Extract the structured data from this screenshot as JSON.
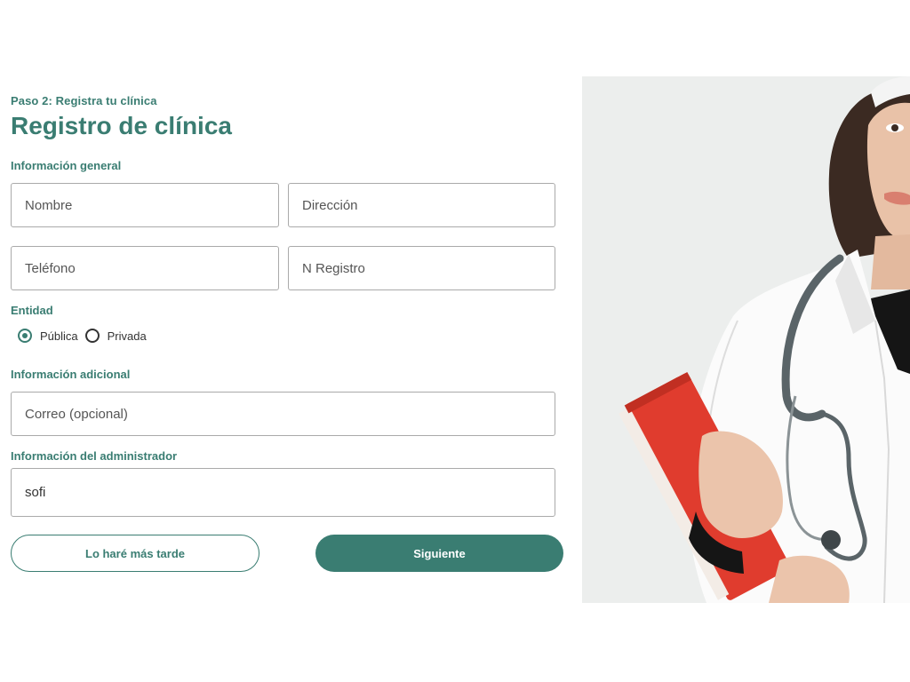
{
  "header": {
    "step": "Paso 2: Registra tu clínica",
    "title": "Registro de clínica"
  },
  "general": {
    "label": "Información general",
    "nombre_placeholder": "Nombre",
    "direccion_placeholder": "Dirección",
    "telefono_placeholder": "Teléfono",
    "registro_placeholder": "N Registro"
  },
  "entidad": {
    "label": "Entidad",
    "options": [
      {
        "label": "Pública",
        "selected": true
      },
      {
        "label": "Privada",
        "selected": false
      }
    ]
  },
  "adicional": {
    "label": "Información adicional",
    "correo_placeholder": "Correo (opcional)"
  },
  "admin": {
    "label": "Información del administrador",
    "value": "sofi"
  },
  "buttons": {
    "later": "Lo haré más tarde",
    "next": "Siguiente"
  },
  "colors": {
    "accent": "#3a7d72",
    "coat": "#ffffff",
    "folder": "#e03c2e",
    "stethoscope": "#5a6468",
    "background_photo": "#eceeed"
  },
  "image": {
    "subject": "doctor-with-stethoscope-and-red-folder"
  }
}
